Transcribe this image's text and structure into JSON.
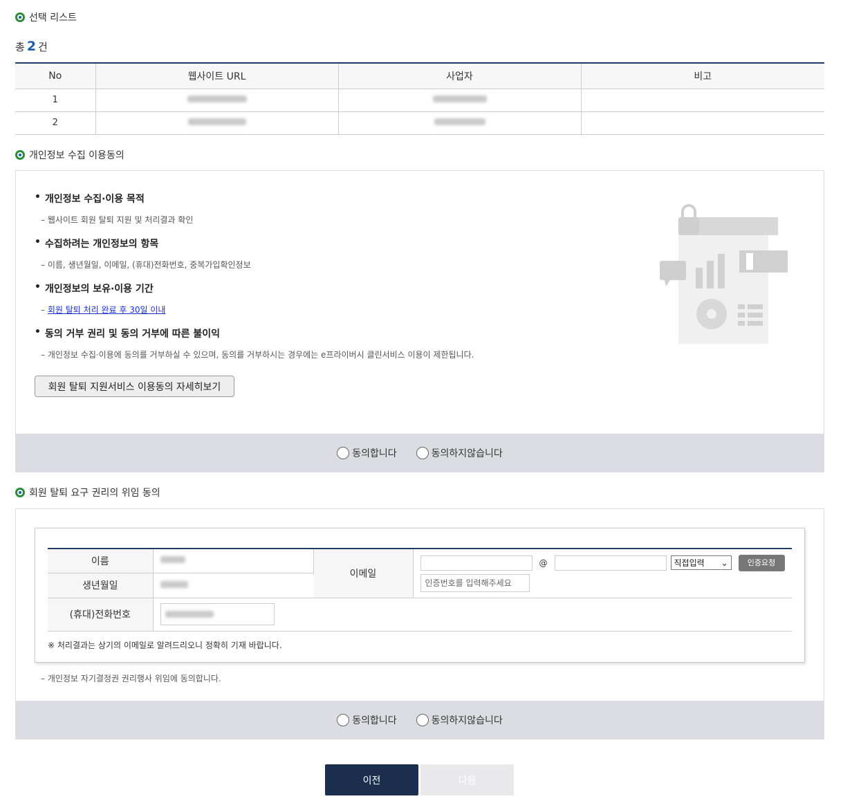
{
  "selection": {
    "title": "선택 리스트",
    "total_prefix": "총",
    "total_count": "2",
    "total_suffix": "건",
    "columns": [
      "No",
      "웹사이트 URL",
      "사업자",
      "비고"
    ],
    "rows": [
      {
        "no": "1",
        "url": "",
        "business": "",
        "note": ""
      },
      {
        "no": "2",
        "url": "",
        "business": "",
        "note": ""
      }
    ]
  },
  "privacy_consent": {
    "title": "개인정보 수집 이용동의",
    "items": [
      {
        "head": "개인정보 수집·이용 목적",
        "desc": "– 웹사이트 회원 탈퇴 지원 및 처리결과 확인"
      },
      {
        "head": "수집하려는 개인정보의 항목",
        "desc": "– 이름, 생년월일, 이메일, (휴대)전화번호, 중복가입확인정보"
      },
      {
        "head": "개인정보의 보유·이용 기간",
        "desc_prefix": "– ",
        "desc_link": "회원 탈퇴 처리 완료 후 30일 이내"
      },
      {
        "head": "동의 거부 권리 및 동의 거부에 따른 불이익",
        "desc": "– 개인정보 수집·이용에 동의를 거부하실 수 있으며, 동의를 거부하시는 경우에는 e프라이버시 클린서비스 이용이 제한됩니다."
      }
    ],
    "detail_button": "회원 탈퇴 지원서비스 이용동의 자세히보기",
    "agree_label": "동의합니다",
    "disagree_label": "동의하지않습니다"
  },
  "delegation": {
    "title": "회원 탈퇴 요구 권리의 위임 동의",
    "name_label": "이름",
    "birth_label": "생년월일",
    "phone_label": "(휴대)전화번호",
    "email_label": "이메일",
    "at_sign": "@",
    "domain_select": "직접입력",
    "verify_button": "인증요청",
    "code_placeholder": "인증번호를 입력해주세요",
    "note": "※ 처리결과는 상기의 이메일로 알려드리오니 정확히 기재 바랍니다.",
    "desc": "– 개인정보 자기결정권 권리행사 위임에 동의합니다.",
    "agree_label": "동의합니다",
    "disagree_label": "동의하지않습니다"
  },
  "nav": {
    "prev": "이전",
    "next": "다음"
  },
  "colors": {
    "navy": "#1b2e4e",
    "accent_blue": "#1f5ca8",
    "green": "#2e8b3a",
    "bar_gray": "#dcdde2"
  }
}
